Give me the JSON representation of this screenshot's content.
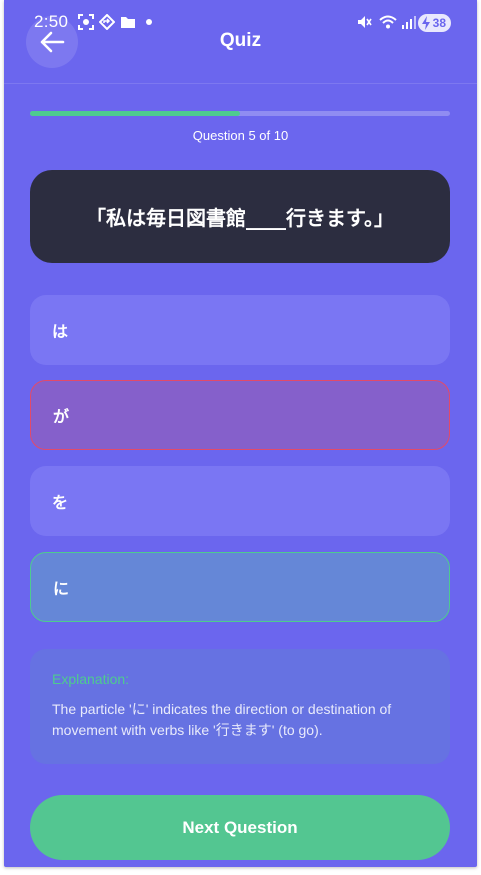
{
  "status_bar": {
    "time": "2:50",
    "battery": "38"
  },
  "header": {
    "title": "Quiz"
  },
  "progress": {
    "label": "Question 5 of 10",
    "fraction": 0.5
  },
  "question": {
    "text": "「私は毎日図書館____行きます。」"
  },
  "options": [
    {
      "label": "は",
      "state": "default"
    },
    {
      "label": "が",
      "state": "wrong"
    },
    {
      "label": "を",
      "state": "default"
    },
    {
      "label": "に",
      "state": "correct"
    }
  ],
  "explanation": {
    "title": "Explanation:",
    "text": "The particle 'に' indicates the direction or destination of movement with verbs like '行きます' (to go)."
  },
  "next_button": {
    "label": "Next Question"
  },
  "colors": {
    "background": "#6b66ee",
    "correct": "#4ecb8f",
    "wrong": "#e24a6a",
    "question_card": "#2c2d40"
  }
}
